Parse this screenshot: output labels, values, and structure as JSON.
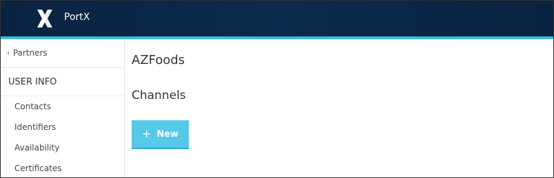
{
  "header": {
    "app_title": "PortX",
    "logo_icon": "portx-logo-icon",
    "accent_color": "#3fb9da",
    "bar_color": "#0b2646"
  },
  "sidebar": {
    "back_label": "Partners",
    "section_title": "USER INFO",
    "items": [
      {
        "label": "Contacts"
      },
      {
        "label": "Identifiers"
      },
      {
        "label": "Availability"
      },
      {
        "label": "Certificates"
      }
    ]
  },
  "main": {
    "company_name": "AZFoods",
    "section_title": "Channels",
    "new_button_label": "New",
    "new_button_icon": "plus-icon",
    "button_color": "#56c8e8"
  }
}
